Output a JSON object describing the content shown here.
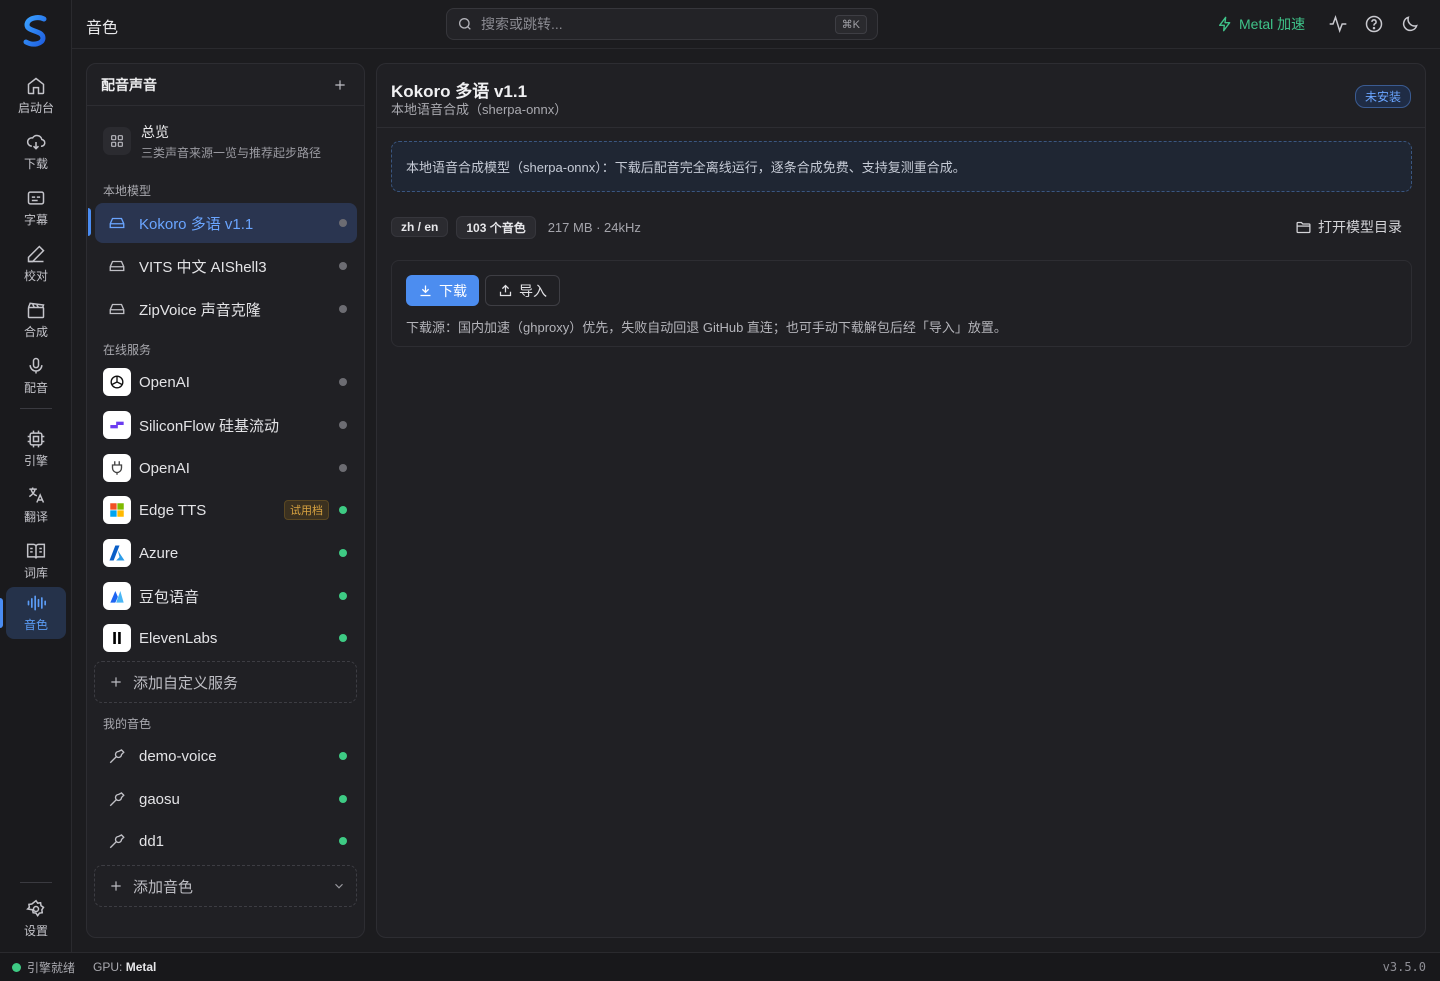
{
  "app": {
    "title": "音色"
  },
  "nav": {
    "items": [
      {
        "label": "启动台",
        "icon": "home-icon"
      },
      {
        "label": "下载",
        "icon": "cloud-download-icon"
      },
      {
        "label": "字幕",
        "icon": "subtitles-icon"
      },
      {
        "label": "校对",
        "icon": "pen-icon"
      },
      {
        "label": "合成",
        "icon": "clapperboard-icon"
      },
      {
        "label": "配音",
        "icon": "microphone-icon"
      },
      {
        "label": "引擎",
        "icon": "cpu-icon"
      },
      {
        "label": "翻译",
        "icon": "translate-icon"
      },
      {
        "label": "词库",
        "icon": "book-icon"
      },
      {
        "label": "音色",
        "icon": "waveform-icon",
        "active": true
      }
    ],
    "settings_label": "设置"
  },
  "search": {
    "placeholder": "搜索或跳转...",
    "shortcut": "⌘K"
  },
  "topbar": {
    "metal_label": "Metal 加速",
    "accent": "#3fc389"
  },
  "voices": {
    "title": "配音声音",
    "overview": {
      "title": "总览",
      "subtitle": "三类声音来源一览与推荐起步路径"
    },
    "local_label": "本地模型",
    "local": [
      {
        "name": "Kokoro 多语 v1.1",
        "active": true,
        "status": "gray"
      },
      {
        "name": "VITS 中文 AIShell3",
        "status": "gray"
      },
      {
        "name": "ZipVoice 声音克隆",
        "status": "gray"
      }
    ],
    "online_label": "在线服务",
    "online": [
      {
        "name": "OpenAI",
        "icon": "openai-logo-icon",
        "status": "gray"
      },
      {
        "name": "SiliconFlow 硅基流动",
        "icon": "siliconflow-logo-icon",
        "status": "gray"
      },
      {
        "name": "OpenAI",
        "icon": "plug-icon",
        "status": "gray"
      },
      {
        "name": "Edge TTS",
        "icon": "microsoft-logo-icon",
        "badge": "试用档",
        "status": "green"
      },
      {
        "name": "Azure",
        "icon": "azure-logo-icon",
        "status": "green"
      },
      {
        "name": "豆包语音",
        "icon": "doubao-logo-icon",
        "status": "green"
      },
      {
        "name": "ElevenLabs",
        "icon": "elevenlabs-logo-icon",
        "status": "green"
      }
    ],
    "add_service": "添加自定义服务",
    "mine_label": "我的音色",
    "mine": [
      {
        "name": "demo-voice",
        "status": "green"
      },
      {
        "name": "gaosu",
        "status": "green"
      },
      {
        "name": "dd1",
        "status": "green"
      }
    ],
    "add_voice": "添加音色"
  },
  "detail": {
    "title": "Kokoro 多语 v1.1",
    "subtitle": "本地语音合成（sherpa-onnx）",
    "status": "未安装",
    "info": "本地语音合成模型（sherpa-onnx）：下载后配音完全离线运行，逐条合成免费、支持复测重合成。",
    "lang_chip": "zh / en",
    "voices_chip": "103 个音色",
    "meta": "217 MB · 24kHz",
    "open_dir": "打开模型目录",
    "download_label": "下载",
    "import_label": "导入",
    "download_note": "下载源：国内加速（ghproxy）优先，失败自动回退 GitHub 直连；也可手动下载解包后经「导入」放置。"
  },
  "statusbar": {
    "engine": "引擎就绪",
    "gpu_label": "GPU:",
    "gpu_value": "Metal",
    "version": "v3.5.0"
  }
}
